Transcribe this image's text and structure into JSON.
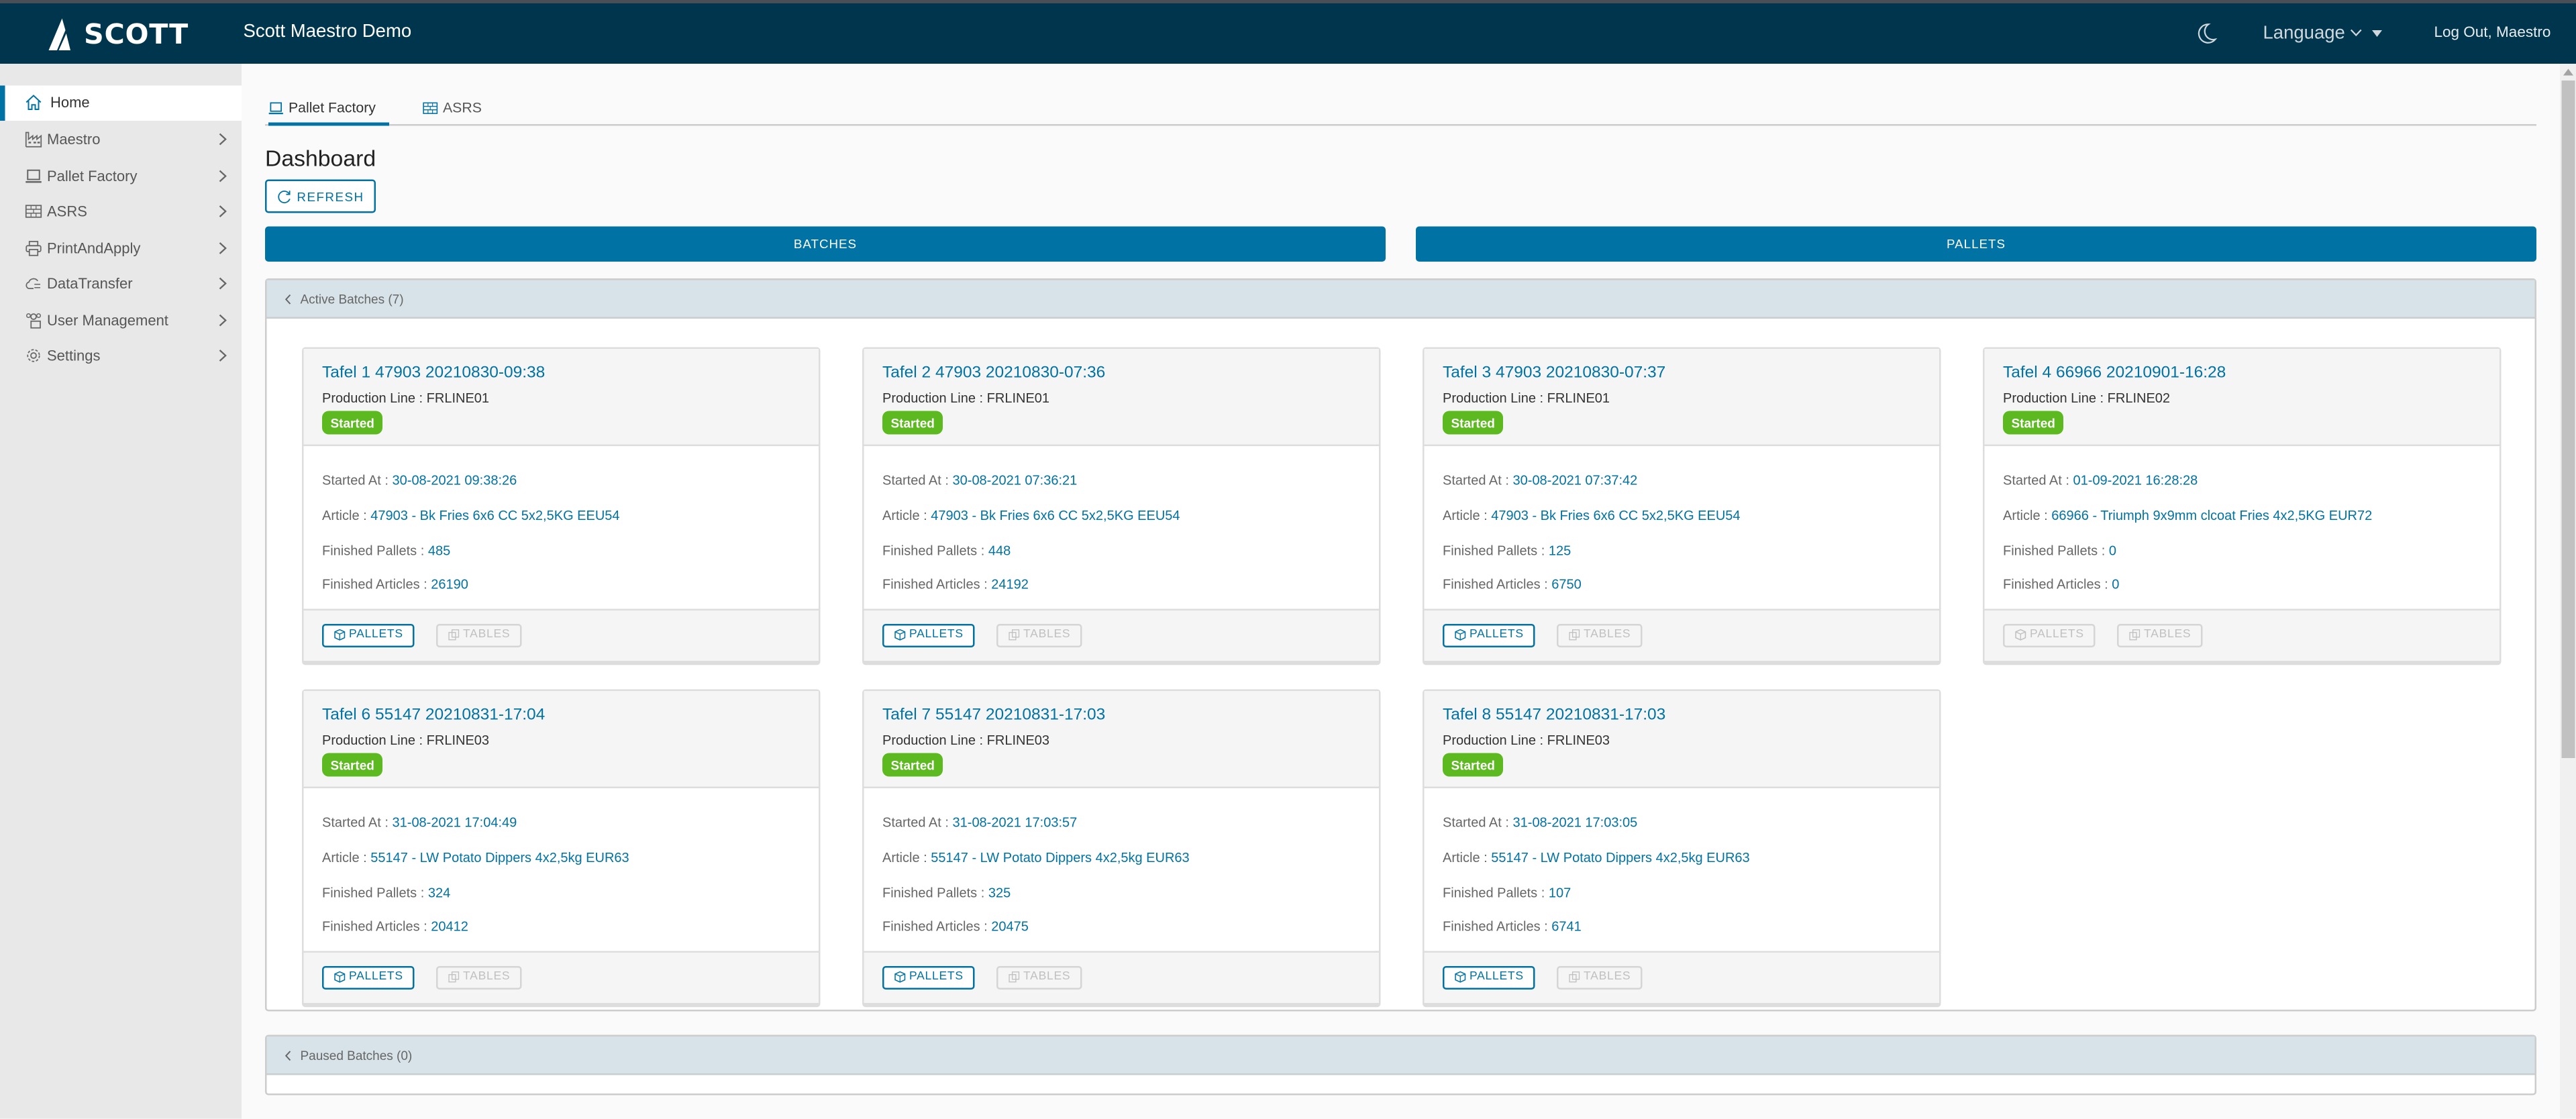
{
  "header": {
    "logo_text": "SCOTT",
    "app_title": "Scott Maestro Demo",
    "theme_icon": "moon-icon",
    "language_label": "Language",
    "logout_label": "Log Out, Maestro"
  },
  "sidebar": {
    "items": [
      {
        "label": "Home",
        "icon": "home-icon",
        "active": true,
        "has_chevron": false
      },
      {
        "label": "Maestro",
        "icon": "factory-icon",
        "active": false,
        "has_chevron": true
      },
      {
        "label": "Pallet Factory",
        "icon": "laptop-icon",
        "active": false,
        "has_chevron": true
      },
      {
        "label": "ASRS",
        "icon": "rack-icon",
        "active": false,
        "has_chevron": true
      },
      {
        "label": "PrintAndApply",
        "icon": "printer-icon",
        "active": false,
        "has_chevron": true
      },
      {
        "label": "DataTransfer",
        "icon": "cloud-transfer-icon",
        "active": false,
        "has_chevron": true
      },
      {
        "label": "User Management",
        "icon": "users-icon",
        "active": false,
        "has_chevron": true
      },
      {
        "label": "Settings",
        "icon": "gear-icon",
        "active": false,
        "has_chevron": true
      }
    ]
  },
  "tabs": [
    {
      "label": "Pallet Factory",
      "icon": "laptop-icon",
      "active": true
    },
    {
      "label": "ASRS",
      "icon": "rack-icon",
      "active": false
    }
  ],
  "page": {
    "title": "Dashboard",
    "refresh_label": "REFRESH",
    "batches_label": "BATCHES",
    "pallets_label": "PALLETS"
  },
  "active_batches": {
    "title": "Active Batches (7)",
    "labels": {
      "production_line": "Production Line : ",
      "started_at": "Started At : ",
      "article": "Article : ",
      "finished_pallets": "Finished Pallets : ",
      "finished_articles": "Finished Articles : ",
      "pallets_btn": "PALLETS",
      "tables_btn": "TABLES"
    },
    "cards": [
      {
        "title": "Tafel 1 47903 20210830-09:38",
        "production_line": "FRLINE01",
        "status": "Started",
        "started_at": "30-08-2021 09:38:26",
        "article": "47903 - Bk Fries 6x6 CC 5x2,5KG EEU54",
        "finished_pallets": "485",
        "finished_articles": "26190",
        "pallets_enabled": true,
        "tables_enabled": false
      },
      {
        "title": "Tafel 2 47903 20210830-07:36",
        "production_line": "FRLINE01",
        "status": "Started",
        "started_at": "30-08-2021 07:36:21",
        "article": "47903 - Bk Fries 6x6 CC 5x2,5KG EEU54",
        "finished_pallets": "448",
        "finished_articles": "24192",
        "pallets_enabled": true,
        "tables_enabled": false
      },
      {
        "title": "Tafel 3 47903 20210830-07:37",
        "production_line": "FRLINE01",
        "status": "Started",
        "started_at": "30-08-2021 07:37:42",
        "article": "47903 - Bk Fries 6x6 CC 5x2,5KG EEU54",
        "finished_pallets": "125",
        "finished_articles": "6750",
        "pallets_enabled": true,
        "tables_enabled": false
      },
      {
        "title": "Tafel 4 66966 20210901-16:28",
        "production_line": "FRLINE02",
        "status": "Started",
        "started_at": "01-09-2021 16:28:28",
        "article": "66966 - Triumph 9x9mm clcoat Fries 4x2,5KG EUR72",
        "finished_pallets": "0",
        "finished_articles": "0",
        "pallets_enabled": false,
        "tables_enabled": false
      },
      {
        "title": "Tafel 6 55147 20210831-17:04",
        "production_line": "FRLINE03",
        "status": "Started",
        "started_at": "31-08-2021 17:04:49",
        "article": "55147 - LW Potato Dippers 4x2,5kg EUR63",
        "finished_pallets": "324",
        "finished_articles": "20412",
        "pallets_enabled": true,
        "tables_enabled": false
      },
      {
        "title": "Tafel 7 55147 20210831-17:03",
        "production_line": "FRLINE03",
        "status": "Started",
        "started_at": "31-08-2021 17:03:57",
        "article": "55147 - LW Potato Dippers 4x2,5kg EUR63",
        "finished_pallets": "325",
        "finished_articles": "20475",
        "pallets_enabled": true,
        "tables_enabled": false
      },
      {
        "title": "Tafel 8 55147 20210831-17:03",
        "production_line": "FRLINE03",
        "status": "Started",
        "started_at": "31-08-2021 17:03:05",
        "article": "55147 - LW Potato Dippers 4x2,5kg EUR63",
        "finished_pallets": "107",
        "finished_articles": "6741",
        "pallets_enabled": true,
        "tables_enabled": false
      }
    ]
  },
  "paused_batches": {
    "title": "Paused Batches (0)"
  },
  "colors": {
    "header_bg": "#00364d",
    "accent": "#0072a3",
    "status_started": "#5cb91f",
    "panel_header": "#d8e3e9"
  }
}
